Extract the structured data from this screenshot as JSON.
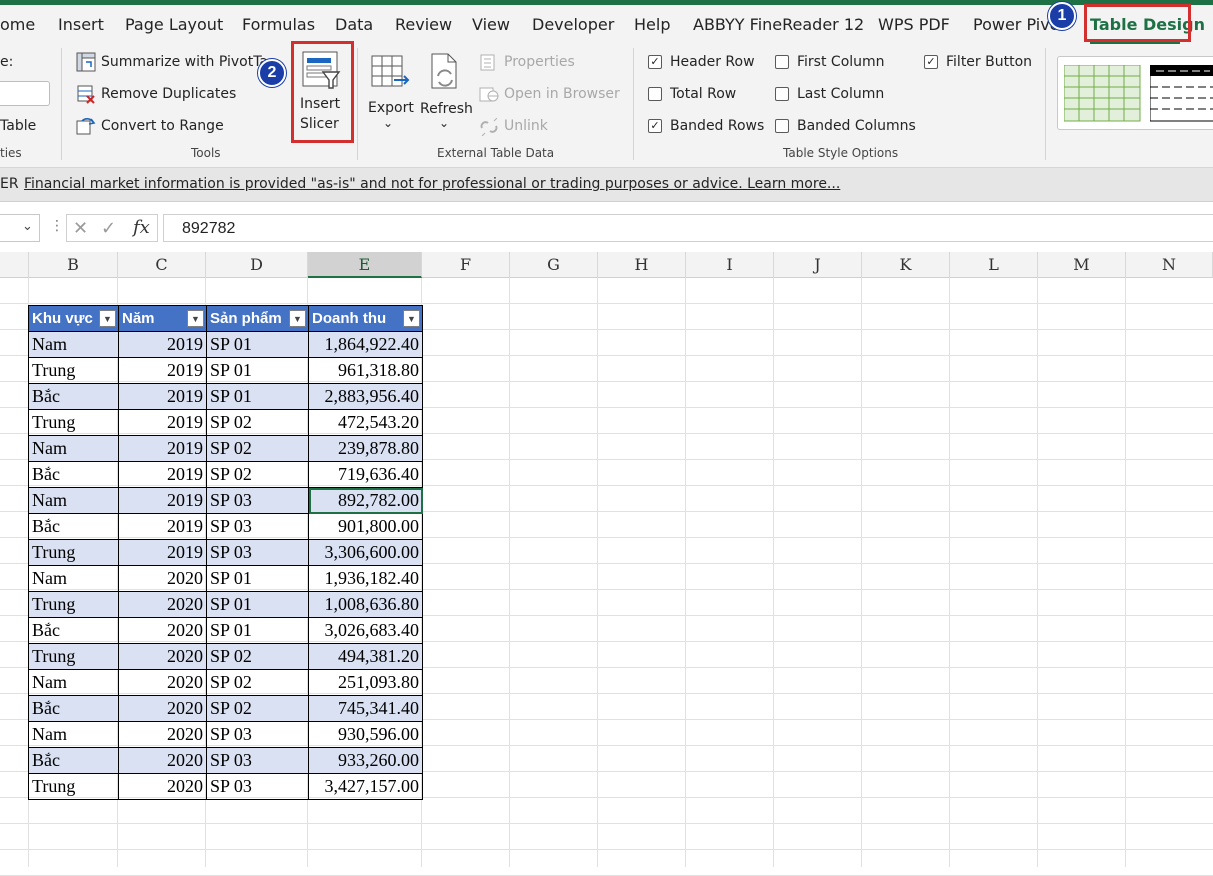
{
  "tabs": [
    "ome",
    "Insert",
    "Page Layout",
    "Formulas",
    "Data",
    "Review",
    "View",
    "Developer",
    "Help",
    "ABBYY FineReader 12",
    "WPS PDF",
    "Power Pivo",
    "Table Design"
  ],
  "ribbon": {
    "props": {
      "name_label": "e:",
      "resize_label": "Table",
      "group": "ties"
    },
    "tools": {
      "summarize": "Summarize with PivotTa",
      "remove_dup": "Remove Duplicates",
      "convert": "Convert to Range",
      "slicer_1": "Insert",
      "slicer_2": "Slicer",
      "group": "Tools"
    },
    "external": {
      "export": "Export",
      "refresh": "Refresh",
      "properties": "Properties",
      "open_browser": "Open in Browser",
      "unlink": "Unlink",
      "group": "External Table Data"
    },
    "style_options": {
      "header_row": "Header Row",
      "total_row": "Total Row",
      "banded_rows": "Banded Rows",
      "first_column": "First Column",
      "last_column": "Last Column",
      "banded_columns": "Banded Columns",
      "filter_button": "Filter Button",
      "group": "Table Style Options"
    }
  },
  "infobar": {
    "prefix": "ER",
    "message": "Financial market information is provided \"as-is\" and not for professional or trading purposes or advice. Learn more..."
  },
  "formula": {
    "value": "892782"
  },
  "columns": [
    "B",
    "C",
    "D",
    "E",
    "F",
    "G",
    "H",
    "I",
    "J",
    "K",
    "L",
    "M",
    "N"
  ],
  "table": {
    "headers": [
      "Khu vực",
      "Năm",
      "Sản phẩm",
      "Doanh thu"
    ],
    "rows": [
      [
        "Nam",
        "2019",
        "SP 01",
        "1,864,922.40"
      ],
      [
        "Trung",
        "2019",
        "SP 01",
        "961,318.80"
      ],
      [
        "Bắc",
        "2019",
        "SP 01",
        "2,883,956.40"
      ],
      [
        "Trung",
        "2019",
        "SP 02",
        "472,543.20"
      ],
      [
        "Nam",
        "2019",
        "SP 02",
        "239,878.80"
      ],
      [
        "Bắc",
        "2019",
        "SP 02",
        "719,636.40"
      ],
      [
        "Nam",
        "2019",
        "SP 03",
        "892,782.00"
      ],
      [
        "Bắc",
        "2019",
        "SP 03",
        "901,800.00"
      ],
      [
        "Trung",
        "2019",
        "SP 03",
        "3,306,600.00"
      ],
      [
        "Nam",
        "2020",
        "SP 01",
        "1,936,182.40"
      ],
      [
        "Trung",
        "2020",
        "SP 01",
        "1,008,636.80"
      ],
      [
        "Bắc",
        "2020",
        "SP 01",
        "3,026,683.40"
      ],
      [
        "Trung",
        "2020",
        "SP 02",
        "494,381.20"
      ],
      [
        "Nam",
        "2020",
        "SP 02",
        "251,093.80"
      ],
      [
        "Bắc",
        "2020",
        "SP 02",
        "745,341.40"
      ],
      [
        "Nam",
        "2020",
        "SP 03",
        "930,596.00"
      ],
      [
        "Bắc",
        "2020",
        "SP 03",
        "933,260.00"
      ],
      [
        "Trung",
        "2020",
        "SP 03",
        "3,427,157.00"
      ]
    ]
  },
  "markers": [
    "1",
    "2"
  ],
  "colors": {
    "excel_green": "#1e7145",
    "table_header": "#4472c4",
    "band": "#d9e1f2",
    "highlight": "#d32f2f",
    "marker": "#1a3da8"
  }
}
